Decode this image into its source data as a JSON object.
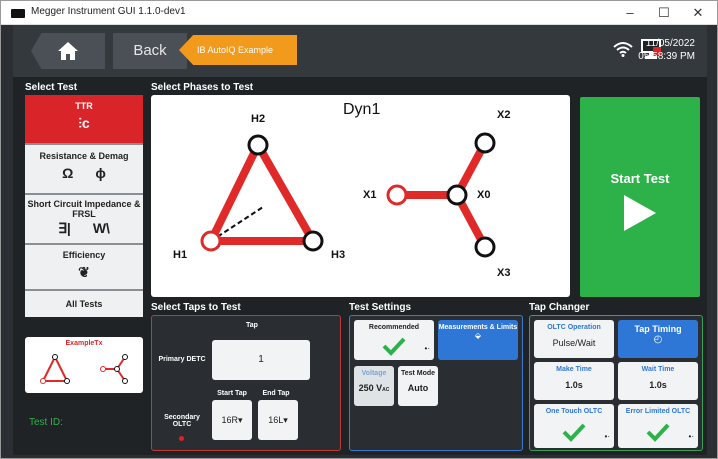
{
  "window": {
    "title": "Megger Instrument GUI 1.1.0-dev1",
    "minimize": "–",
    "maximize": "☐",
    "close": "✕"
  },
  "topbar": {
    "back_label": "Back",
    "breadcrumb": "IB AutoIQ Example",
    "date": "11/05/2022",
    "time": "05:58:39 PM"
  },
  "sections": {
    "select_test": "Select Test",
    "select_phases": "Select Phases to Test",
    "select_taps": "Select Taps to Test",
    "test_settings": "Test Settings",
    "tap_changer": "Tap Changer"
  },
  "tests": [
    {
      "label": "TTR"
    },
    {
      "label": "Resistance & Demag"
    },
    {
      "label": "Short Circuit Impedance & FRSL"
    },
    {
      "label": "Efficiency"
    },
    {
      "label": "All Tests"
    }
  ],
  "phases": {
    "vector_group": "Dyn1",
    "h1": "H1",
    "h2": "H2",
    "h3": "H3",
    "x0": "X0",
    "x1": "X1",
    "x2": "X2",
    "x3": "X3"
  },
  "start": {
    "label": "Start Test"
  },
  "example": {
    "label": "ExampleTx"
  },
  "test_id": {
    "label": "Test ID:"
  },
  "taps": {
    "tap_label": "Tap",
    "primary_label": "Primary DETC",
    "primary_value": "1",
    "secondary_label": "Secondary OLTC",
    "start_tap_label": "Start Tap",
    "end_tap_label": "End Tap",
    "start_tap_value": "16R",
    "end_tap_value": "16L"
  },
  "settings": {
    "recommended": "Recommended",
    "measurements": "Measurements & Limits",
    "voltage_label": "Voltage",
    "voltage_value": "250 V",
    "voltage_unit": "AC",
    "test_mode_label": "Test Mode",
    "test_mode_value": "Auto"
  },
  "tapchanger": {
    "oltc_operation_label": "OLTC Operation",
    "oltc_operation_value": "Pulse/Wait",
    "tap_timing": "Tap Timing",
    "make_time_label": "Make Time",
    "make_time_value": "1.0s",
    "wait_time_label": "Wait Time",
    "wait_time_value": "1.0s",
    "one_touch": "One Touch OLTC",
    "error_limited": "Error Limited OLTC"
  },
  "colors": {
    "accent_red": "#d9252a",
    "accent_green": "#2db24a",
    "accent_blue": "#2f77d6",
    "accent_orange": "#f29a1c"
  }
}
